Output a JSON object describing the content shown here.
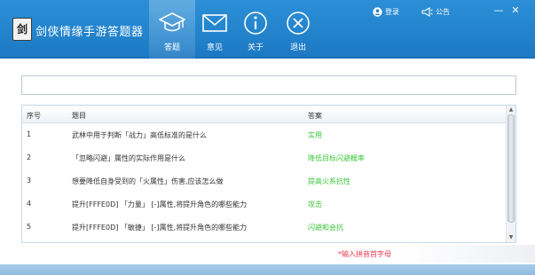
{
  "header": {
    "logo_text": "剑",
    "app_title": "剑侠情缘手游答题器",
    "tabs": [
      {
        "label": "答题",
        "icon": "graduation-cap-icon"
      },
      {
        "label": "意见",
        "icon": "envelope-icon"
      },
      {
        "label": "关于",
        "icon": "info-icon"
      },
      {
        "label": "退出",
        "icon": "close-circle-icon"
      }
    ],
    "login_label": "登录",
    "notice_label": "公告",
    "min_label": "—",
    "close_label": "✕"
  },
  "search": {
    "value": "",
    "placeholder": ""
  },
  "table": {
    "columns": [
      "序号",
      "题目",
      "答案"
    ],
    "rows": [
      {
        "no": "1",
        "question": "武林中用于判断「战力」高低标准的是什么",
        "answer": "实用"
      },
      {
        "no": "2",
        "question": "「忽略闪避」属性的实际作用是什么",
        "answer": "降低目标闪避概率"
      },
      {
        "no": "3",
        "question": "想要降低自身受到的「火属性」伤害,应该怎么做",
        "answer": "提高火系抗性"
      },
      {
        "no": "4",
        "question": "提升[FFFE0D] 「力量」 [-]属性,将提升角色的哪些能力",
        "answer": "攻击"
      },
      {
        "no": "5",
        "question": "提升[FFFE0D] 「敏捷」 [-]属性,将提升角色的哪些能力",
        "answer": "闪避和会抗"
      }
    ]
  },
  "hint": "*输入拼音首字母",
  "colors": {
    "header_blue": "#2384cd",
    "answer_green": "#3cc63c",
    "hint_red": "#e8384f"
  }
}
